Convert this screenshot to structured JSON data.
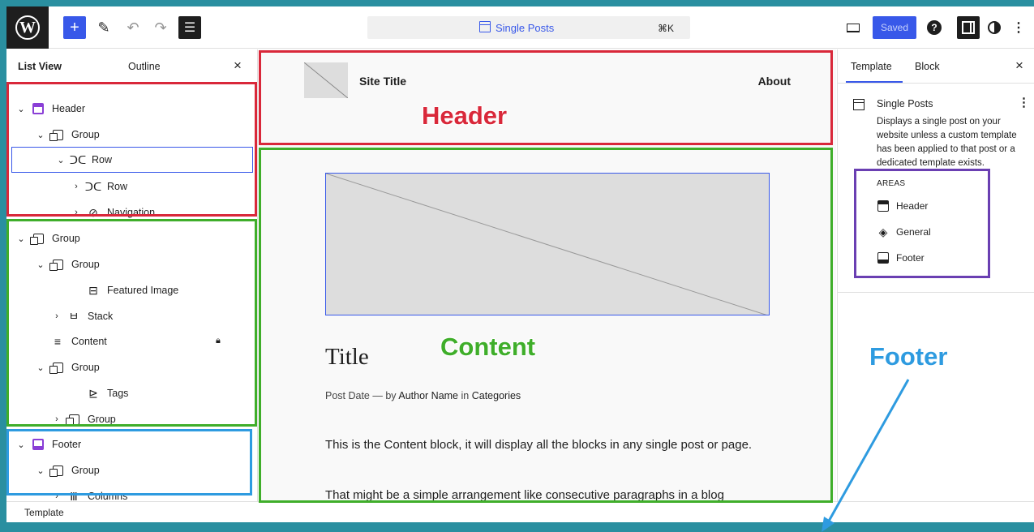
{
  "topbar": {
    "add_icon": "plus-icon",
    "command_title": "Single Posts",
    "command_shortcut": "⌘K",
    "saved_label": "Saved"
  },
  "list_view": {
    "tab_list_view": "List View",
    "tab_outline": "Outline",
    "items": [
      {
        "label": "Header",
        "icon": "template-part-icon",
        "expanded": true
      },
      {
        "label": "Group",
        "icon": "group-icon",
        "expanded": true
      },
      {
        "label": "Row",
        "icon": "row-icon",
        "expanded": true,
        "selected": true
      },
      {
        "label": "Row",
        "icon": "row-icon",
        "expanded": false
      },
      {
        "label": "Navigation",
        "icon": "navigation-icon",
        "expanded": false
      },
      {
        "label": "Group",
        "icon": "group-icon",
        "expanded": true
      },
      {
        "label": "Group",
        "icon": "group-icon",
        "expanded": true
      },
      {
        "label": "Featured Image",
        "icon": "featured-image-icon"
      },
      {
        "label": "Stack",
        "icon": "stack-icon",
        "expanded": false
      },
      {
        "label": "Content",
        "icon": "content-icon",
        "locked": true
      },
      {
        "label": "Group",
        "icon": "group-icon",
        "expanded": true
      },
      {
        "label": "Tags",
        "icon": "tags-icon"
      },
      {
        "label": "Group",
        "icon": "group-icon",
        "expanded": false
      },
      {
        "label": "Footer",
        "icon": "template-part-icon",
        "expanded": true
      },
      {
        "label": "Group",
        "icon": "group-icon",
        "expanded": true
      },
      {
        "label": "Columns",
        "icon": "columns-icon",
        "expanded": false
      }
    ]
  },
  "canvas": {
    "site_title": "Site Title",
    "nav_item": "About",
    "post_title": "Title",
    "meta_date": "Post Date",
    "meta_sep": "—",
    "meta_by": "by",
    "meta_author": "Author Name",
    "meta_in": "in",
    "meta_categories": "Categories",
    "paragraph_1": "This is the Content block, it will display all the blocks in any single post or page.",
    "paragraph_2": "That might be a simple arrangement like consecutive paragraphs in a blog"
  },
  "sidebar": {
    "tab_template": "Template",
    "tab_block": "Block",
    "template_name": "Single Posts",
    "template_description": "Displays a single post on your website unless a custom template has been applied to that post or a dedicated template exists.",
    "areas_title": "AREAS",
    "areas": [
      "Header",
      "General",
      "Footer"
    ]
  },
  "statusbar": {
    "breadcrumb": "Template"
  },
  "annotations": {
    "header": "Header",
    "content": "Content",
    "footer": "Footer",
    "colors": {
      "header": "#d9283a",
      "content": "#3fae2a",
      "footer": "#2e9be0",
      "areas": "#6a3fb2"
    }
  }
}
